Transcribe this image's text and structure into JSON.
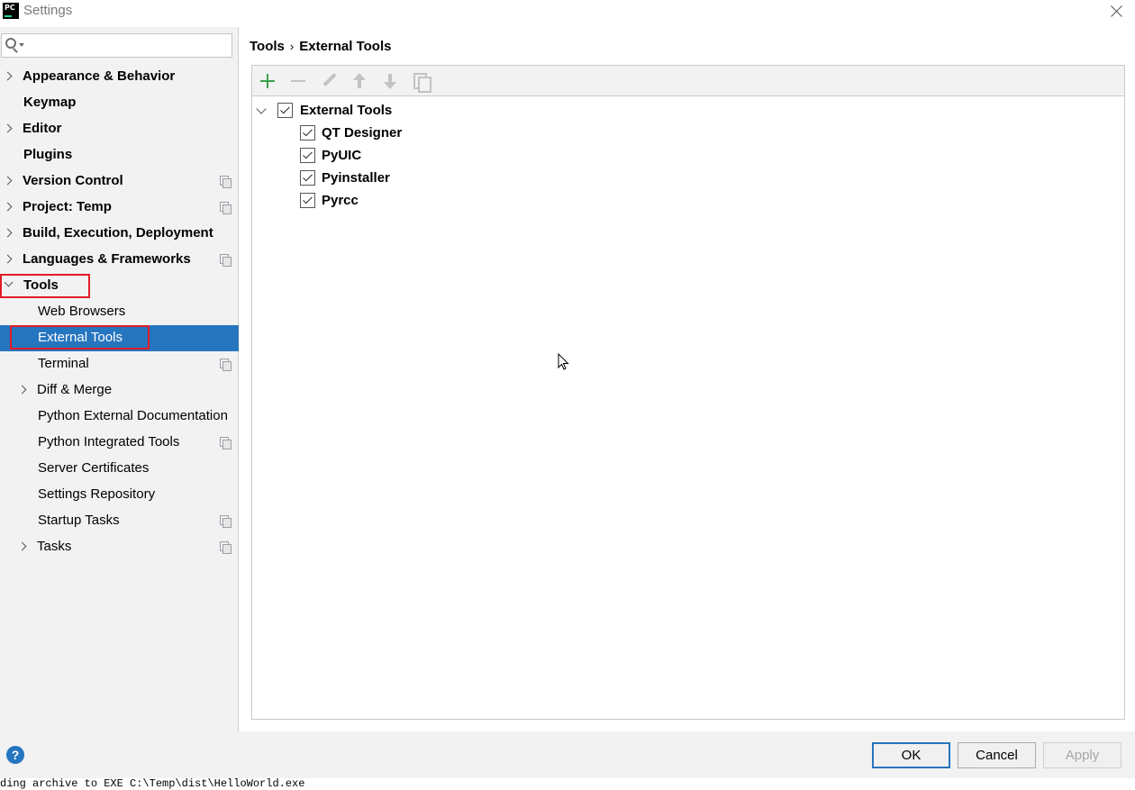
{
  "window": {
    "title": "Settings",
    "app_icon_text": "PC"
  },
  "search": {
    "placeholder": "",
    "value": ""
  },
  "sidebar": {
    "items": [
      {
        "label": "Appearance & Behavior",
        "expandable": true,
        "copy_icon": false
      },
      {
        "label": "Keymap",
        "expandable": false,
        "copy_icon": false
      },
      {
        "label": "Editor",
        "expandable": true,
        "copy_icon": false
      },
      {
        "label": "Plugins",
        "expandable": false,
        "copy_icon": false
      },
      {
        "label": "Version Control",
        "expandable": true,
        "copy_icon": true
      },
      {
        "label": "Project: Temp",
        "expandable": true,
        "copy_icon": true
      },
      {
        "label": "Build, Execution, Deployment",
        "expandable": true,
        "copy_icon": false
      },
      {
        "label": "Languages & Frameworks",
        "expandable": true,
        "copy_icon": true
      },
      {
        "label": "Tools",
        "expanded": true,
        "copy_icon": false
      },
      {
        "label": "Web Browsers",
        "copy_icon": false
      },
      {
        "label": "External Tools",
        "selected": true,
        "copy_icon": false
      },
      {
        "label": "Terminal",
        "copy_icon": true
      },
      {
        "label": "Diff & Merge",
        "expandable": true,
        "copy_icon": false
      },
      {
        "label": "Python External Documentation",
        "copy_icon": false
      },
      {
        "label": "Python Integrated Tools",
        "copy_icon": true
      },
      {
        "label": "Server Certificates",
        "copy_icon": false
      },
      {
        "label": "Settings Repository",
        "copy_icon": false
      },
      {
        "label": "Startup Tasks",
        "copy_icon": true
      },
      {
        "label": "Tasks",
        "expandable": true,
        "copy_icon": true
      }
    ]
  },
  "breadcrumb": {
    "parent": "Tools",
    "separator": "›",
    "current": "External Tools"
  },
  "toolbar": {
    "buttons": [
      {
        "icon": "plus-icon",
        "enabled": true
      },
      {
        "icon": "minus-icon",
        "enabled": false
      },
      {
        "icon": "pencil-icon",
        "enabled": false
      },
      {
        "icon": "arrow-up-icon",
        "enabled": false
      },
      {
        "icon": "arrow-down-icon",
        "enabled": false
      },
      {
        "icon": "copy-icon",
        "enabled": false
      }
    ]
  },
  "tree": {
    "group": {
      "label": "External Tools",
      "checked": true,
      "expanded": true
    },
    "tools": [
      {
        "label": "QT Designer",
        "checked": true
      },
      {
        "label": "PyUIC",
        "checked": true
      },
      {
        "label": "Pyinstaller",
        "checked": true
      },
      {
        "label": "Pyrcc",
        "checked": true
      }
    ]
  },
  "buttons": {
    "ok": "OK",
    "cancel": "Cancel",
    "apply": "Apply",
    "help": "?"
  },
  "status_line": "ding archive to EXE C:\\Temp\\dist\\HelloWorld.exe",
  "colors": {
    "selection": "#2675bf",
    "highlight_box": "#e11c24",
    "add_icon": "#39a04a"
  }
}
